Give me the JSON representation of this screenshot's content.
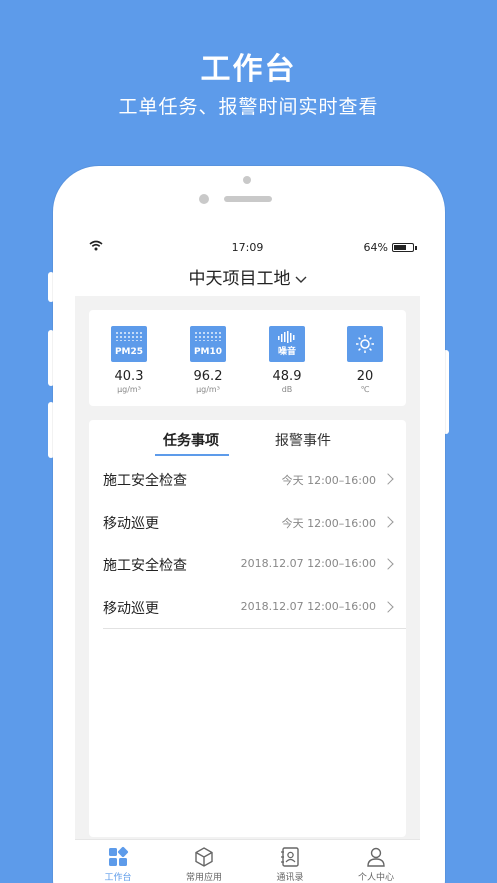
{
  "promo": {
    "title": "工作台",
    "subtitle": "工单任务、报警时间实时查看"
  },
  "status_bar": {
    "time": "17:09",
    "battery": "64%",
    "battery_level": 0.64
  },
  "header": {
    "project_name": "中天项目工地",
    "dropdown_icon": "chevron-down-icon"
  },
  "sensors": [
    {
      "icon_label": "PM25",
      "icon": "pm25-icon",
      "value": "40.3",
      "unit": "μg/m³"
    },
    {
      "icon_label": "PM10",
      "icon": "pm10-icon",
      "value": "96.2",
      "unit": "μg/m³"
    },
    {
      "icon_label": "噪音",
      "icon": "noise-icon",
      "value": "48.9",
      "unit": "dB"
    },
    {
      "icon_label": "",
      "icon": "sun-icon",
      "value": "20",
      "unit": "℃"
    }
  ],
  "tabs": {
    "task": "任务事项",
    "alarm": "报警事件"
  },
  "tasks": [
    {
      "title": "施工安全检查",
      "time": "今天 12:00–16:00"
    },
    {
      "title": "移动巡更",
      "time": "今天 12:00–16:00"
    },
    {
      "title": "施工安全检查",
      "time": "2018.12.07 12:00–16:00"
    },
    {
      "title": "移动巡更",
      "time": "2018.12.07 12:00–16:00"
    }
  ],
  "tabbar": [
    {
      "label": "工作台",
      "icon": "grid-icon",
      "active": true
    },
    {
      "label": "常用应用",
      "icon": "cube-icon",
      "active": false
    },
    {
      "label": "通讯录",
      "icon": "contacts-icon",
      "active": false
    },
    {
      "label": "个人中心",
      "icon": "person-icon",
      "active": false
    }
  ],
  "colors": {
    "accent": "#5d9bea",
    "background": "#f2f2f2"
  }
}
